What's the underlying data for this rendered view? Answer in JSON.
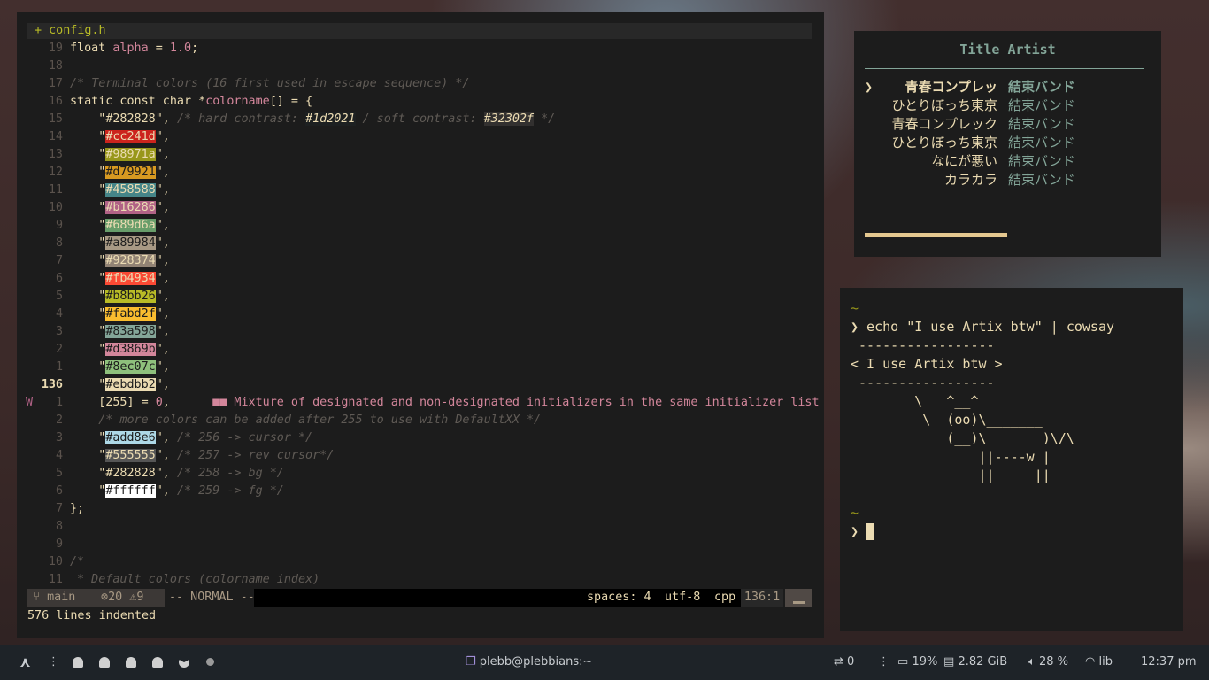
{
  "editor": {
    "tab": "+ config.h",
    "lines": [
      {
        "num": "19",
        "tokens": [
          [
            "kw",
            "float "
          ],
          [
            "var",
            "alpha"
          ],
          [
            "plain",
            " = "
          ],
          [
            "num",
            "1.0"
          ],
          [
            "plain",
            ";"
          ]
        ]
      },
      {
        "num": "18",
        "tokens": []
      },
      {
        "num": "17",
        "tokens": [
          [
            "comment",
            "/* Terminal colors (16 first used in escape sequence) */"
          ]
        ]
      },
      {
        "num": "16",
        "tokens": [
          [
            "kw",
            "static const char "
          ],
          [
            "plain",
            "*"
          ],
          [
            "var",
            "colorname"
          ],
          [
            "plain",
            "[] = {"
          ]
        ]
      },
      {
        "num": "15",
        "tokens": [
          [
            "plain",
            "    \""
          ],
          [
            "plain",
            "#282828"
          ],
          [
            "plain",
            "\", "
          ],
          [
            "comment",
            "/* hard contrast: "
          ],
          [
            "swatchc",
            "#1d2021"
          ],
          [
            "comment",
            " / soft contrast: "
          ],
          [
            "swatchc2",
            "#32302f"
          ],
          [
            "comment",
            " */"
          ]
        ]
      },
      {
        "num": "14",
        "swatch": "#cc241d"
      },
      {
        "num": "13",
        "swatch": "#98971a"
      },
      {
        "num": "12",
        "swatch": "#d79921"
      },
      {
        "num": "11",
        "swatch": "#458588"
      },
      {
        "num": "10",
        "swatch": "#b16286"
      },
      {
        "num": "9",
        "swatch": "#689d6a"
      },
      {
        "num": "8",
        "swatch": "#a89984"
      },
      {
        "num": "7",
        "swatch": "#928374"
      },
      {
        "num": "6",
        "swatch": "#fb4934"
      },
      {
        "num": "5",
        "swatch": "#b8bb26"
      },
      {
        "num": "4",
        "swatch": "#fabd2f"
      },
      {
        "num": "3",
        "swatch": "#83a598"
      },
      {
        "num": "2",
        "swatch": "#d3869b"
      },
      {
        "num": "1",
        "swatch": "#8ec07c"
      },
      {
        "num": "136",
        "current": true,
        "swatch": "#ebdbb2"
      },
      {
        "num": "1",
        "sign": "W",
        "tokens": [
          [
            "plain",
            "    [255] = "
          ],
          [
            "num",
            "0"
          ],
          [
            "plain",
            ",      "
          ],
          [
            "virt",
            "■■ Mixture of designated and non-designated initializers in the same initializer list"
          ]
        ]
      },
      {
        "num": "2",
        "tokens": [
          [
            "comment",
            "    /* more colors can be added after 255 to use with DefaultXX */"
          ]
        ]
      },
      {
        "num": "3",
        "swatch": "#add8e6",
        "after": "/* 256 -> cursor */"
      },
      {
        "num": "4",
        "swatch": "#555555",
        "after": "/* 257 -> rev cursor*/",
        "light": true
      },
      {
        "num": "5",
        "plainsw": "#282828",
        "after": "/* 258 -> bg */"
      },
      {
        "num": "6",
        "swatch": "#ffffff",
        "after": "/* 259 -> fg */"
      },
      {
        "num": "7",
        "tokens": [
          [
            "plain",
            "};"
          ]
        ]
      },
      {
        "num": "8",
        "tokens": []
      },
      {
        "num": "9",
        "tokens": []
      },
      {
        "num": "10",
        "tokens": [
          [
            "comment",
            "/*"
          ]
        ]
      },
      {
        "num": "11",
        "tokens": [
          [
            "comment",
            " * Default colors (colorname index)"
          ]
        ]
      }
    ],
    "status": {
      "branch": "main",
      "errors": "20",
      "warnings": "9",
      "mode": "-- NORMAL --",
      "spaces": "spaces: 4",
      "encoding": "utf-8",
      "filetype": "cpp",
      "position": "136:1"
    },
    "cmdline": "576 lines indented"
  },
  "music": {
    "header": "Title Artist",
    "tracks": [
      {
        "title": "青春コンプレッ",
        "artist": "結束バンド",
        "selected": true
      },
      {
        "title": "ひとりぼっち東京",
        "artist": "結束バンド"
      },
      {
        "title": "青春コンプレック",
        "artist": "結束バンド"
      },
      {
        "title": "ひとりぼっち東京",
        "artist": "結束バンド"
      },
      {
        "title": "なにが悪い",
        "artist": "結束バンド"
      },
      {
        "title": "カラカラ",
        "artist": "結束バンド"
      }
    ],
    "progress": 0.51
  },
  "terminal": {
    "lines": [
      {
        "t": "~",
        "cls": "tilde"
      },
      {
        "t": "❯ echo \"I use Artix btw\" | cowsay"
      },
      {
        "t": " -----------------"
      },
      {
        "t": "< I use Artix btw >"
      },
      {
        "t": " -----------------"
      },
      {
        "t": "        \\   ^__^"
      },
      {
        "t": "         \\  (oo)\\_______"
      },
      {
        "t": "            (__)\\       )\\/\\"
      },
      {
        "t": "                ||----w |"
      },
      {
        "t": "                ||     ||"
      },
      {
        "t": ""
      },
      {
        "t": "~",
        "cls": "tilde"
      },
      {
        "t": "❯ ",
        "cursor": true
      }
    ]
  },
  "taskbar": {
    "window_title": "plebb@plebbians:~",
    "updates": "0",
    "battery": "19%",
    "memory": "2.82 GiB",
    "volume": "28 %",
    "wifi": "lib",
    "clock": "12:37 pm"
  }
}
